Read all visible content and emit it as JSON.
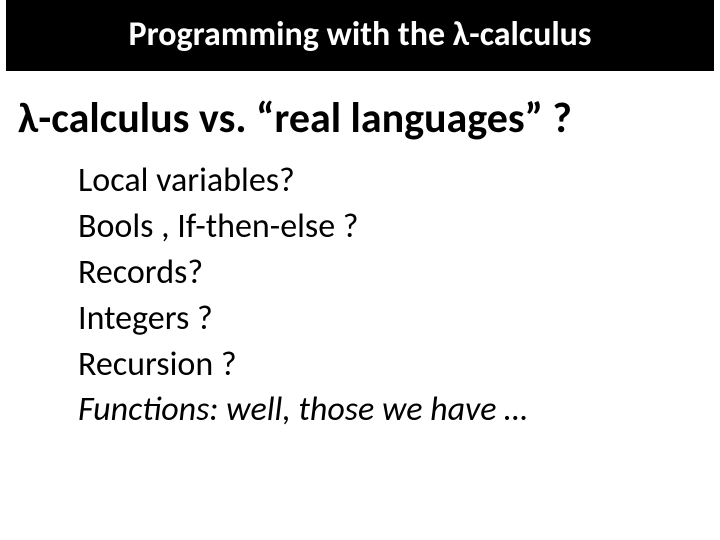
{
  "title": "Programming with the λ-calculus",
  "subheading": "λ-calculus vs. “real languages” ?",
  "items": [
    {
      "text": "Local variables?",
      "italic": false
    },
    {
      "text": "Bools , If-then-else ?",
      "italic": false
    },
    {
      "text": "Records?",
      "italic": false
    },
    {
      "text": "Integers ?",
      "italic": false
    },
    {
      "text": "Recursion ?",
      "italic": false
    },
    {
      "text": "Functions: well, those we have …",
      "italic": true
    }
  ]
}
